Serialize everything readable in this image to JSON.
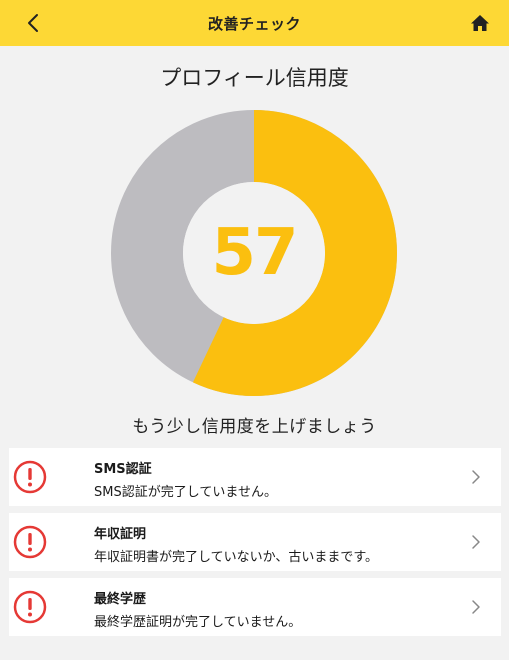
{
  "header": {
    "title": "改善チェック",
    "back_icon": "chevron-left-icon",
    "home_icon": "home-icon",
    "background": "#fdd835"
  },
  "profile": {
    "section_title": "プロフィール信用度",
    "score": "57",
    "score_value": 57,
    "score_max": 100,
    "message": "もう少し信用度を上げましょう",
    "filled_color": "#fbbf0f",
    "remaining_color": "#bdbcc0"
  },
  "items": [
    {
      "title": "SMS認証",
      "description": "SMS認証が完了していません。",
      "icon": "alert-circle-icon"
    },
    {
      "title": "年収証明",
      "description": "年収証明書が完了していないか、古いままです。",
      "icon": "alert-circle-icon"
    },
    {
      "title": "最終学歴",
      "description": "最終学歴証明が完了していません。",
      "icon": "alert-circle-icon"
    }
  ],
  "alert_color": "#e53935"
}
